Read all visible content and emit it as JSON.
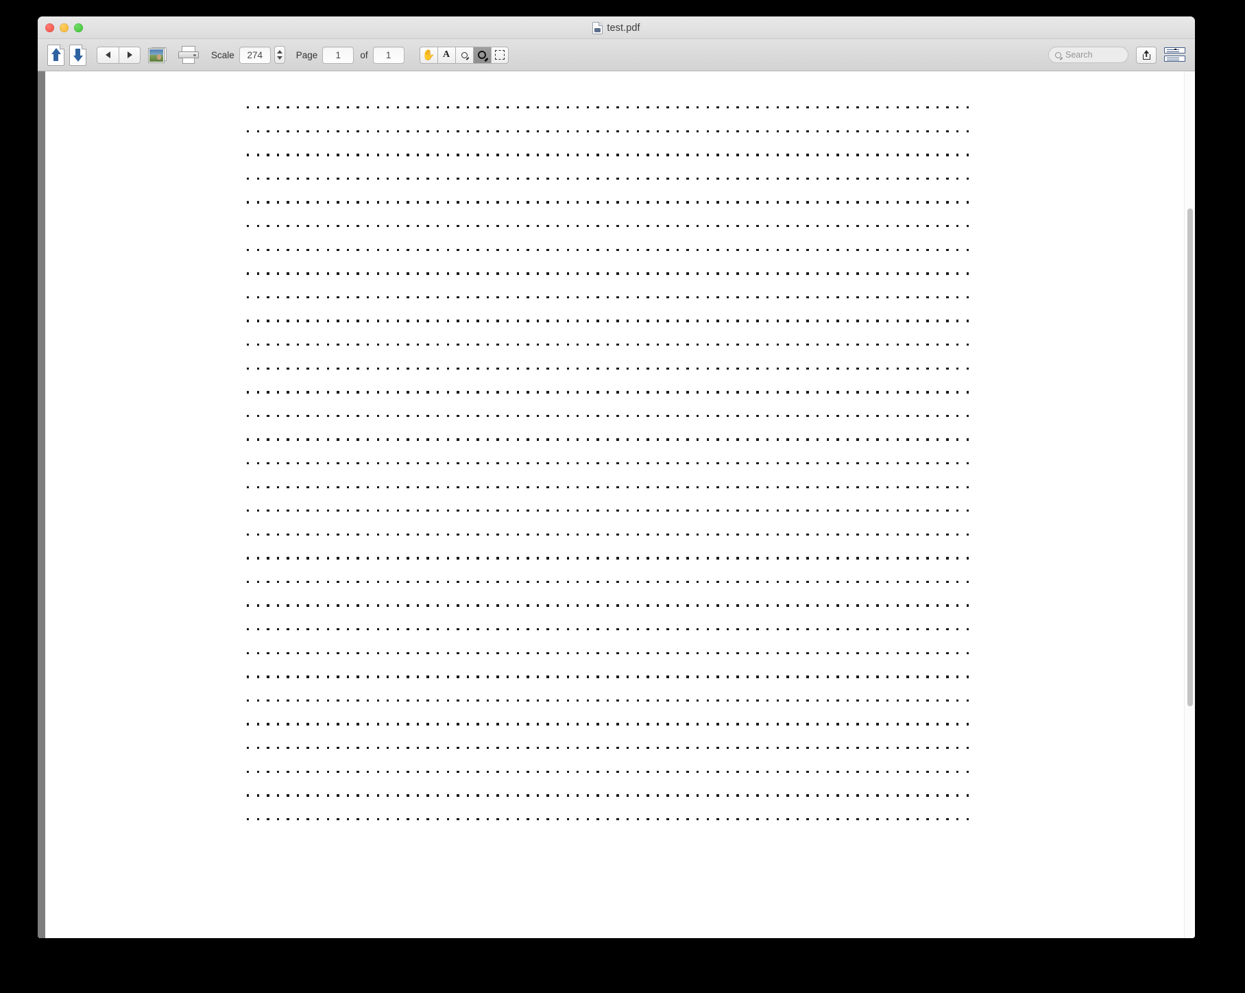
{
  "window": {
    "title": "test.pdf",
    "title_icon": "pdf-document-icon",
    "traffic_lights": [
      {
        "name": "close",
        "color": "#f04a42"
      },
      {
        "name": "minimize",
        "color": "#f5b428"
      },
      {
        "name": "zoom",
        "color": "#35c12c"
      }
    ]
  },
  "toolbar": {
    "page_up_icon": "page-up-icon",
    "page_down_icon": "page-down-icon",
    "previous_page_icon": "triangle-left-icon",
    "next_page_icon": "triangle-right-icon",
    "thumbnail_icon": "thumbnail-photo-icon",
    "print_icon": "printer-icon",
    "scale_label": "Scale",
    "scale_value": "274",
    "stepper_icon": "stepper-up-down-icon",
    "page_label": "Page",
    "page_value": "1",
    "page_of_label": "of",
    "page_count": "1",
    "tools": [
      {
        "name": "hand-tool",
        "icon": "hand-icon",
        "glyph": "✋",
        "active": false
      },
      {
        "name": "text-select-tool",
        "icon": "letter-a-icon",
        "glyph": "A",
        "active": false
      },
      {
        "name": "zoom-out-tool",
        "icon": "magnifier-small-icon",
        "active": false
      },
      {
        "name": "zoom-in-tool",
        "icon": "magnifier-large-icon",
        "active": true
      },
      {
        "name": "marquee-select-tool",
        "icon": "dashed-rectangle-icon",
        "active": false
      }
    ],
    "search_placeholder": "Search",
    "search_value": "",
    "search_icon": "search-icon",
    "share_icon": "share-upload-icon",
    "sidebar_toggle_icon": "page-layout-icon"
  },
  "document": {
    "page_content_type": "dotted-lines",
    "rows": 31,
    "dots_per_row": 73,
    "dot_color": "#1a1a1a",
    "page_background": "#ffffff"
  },
  "scrollbar": {
    "orientation": "vertical",
    "thumb_color": "#c3c3c3",
    "track_color": "#fbfbfb"
  },
  "colors": {
    "desktop_background": "#000000",
    "titlebar": "#e3e3e3",
    "toolbar": "#d8d8d8",
    "left_strip": "#7e7e7e"
  }
}
